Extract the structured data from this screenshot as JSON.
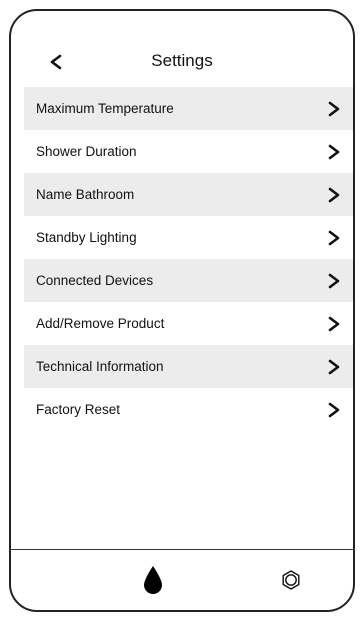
{
  "header": {
    "title": "Settings",
    "back_icon": "chevron-left-icon"
  },
  "settings_items": [
    {
      "label": "Maximum Temperature",
      "shaded": true,
      "icon": "chevron-right-icon"
    },
    {
      "label": "Shower Duration",
      "shaded": false,
      "icon": "chevron-right-icon"
    },
    {
      "label": "Name Bathroom",
      "shaded": true,
      "icon": "chevron-right-icon"
    },
    {
      "label": "Standby Lighting",
      "shaded": false,
      "icon": "chevron-right-icon"
    },
    {
      "label": "Connected Devices",
      "shaded": true,
      "icon": "chevron-right-icon"
    },
    {
      "label": "Add/Remove Product",
      "shaded": false,
      "icon": "chevron-right-icon"
    },
    {
      "label": "Technical Information",
      "shaded": true,
      "icon": "chevron-right-icon"
    },
    {
      "label": "Factory Reset",
      "shaded": false,
      "icon": "chevron-right-icon"
    }
  ],
  "bottom_nav": {
    "tabs": [
      {
        "icon": "water-drop-icon"
      },
      {
        "icon": "gear-icon"
      }
    ]
  },
  "colors": {
    "shaded_row": "#ececec",
    "text": "#111111",
    "border": "#222222"
  }
}
